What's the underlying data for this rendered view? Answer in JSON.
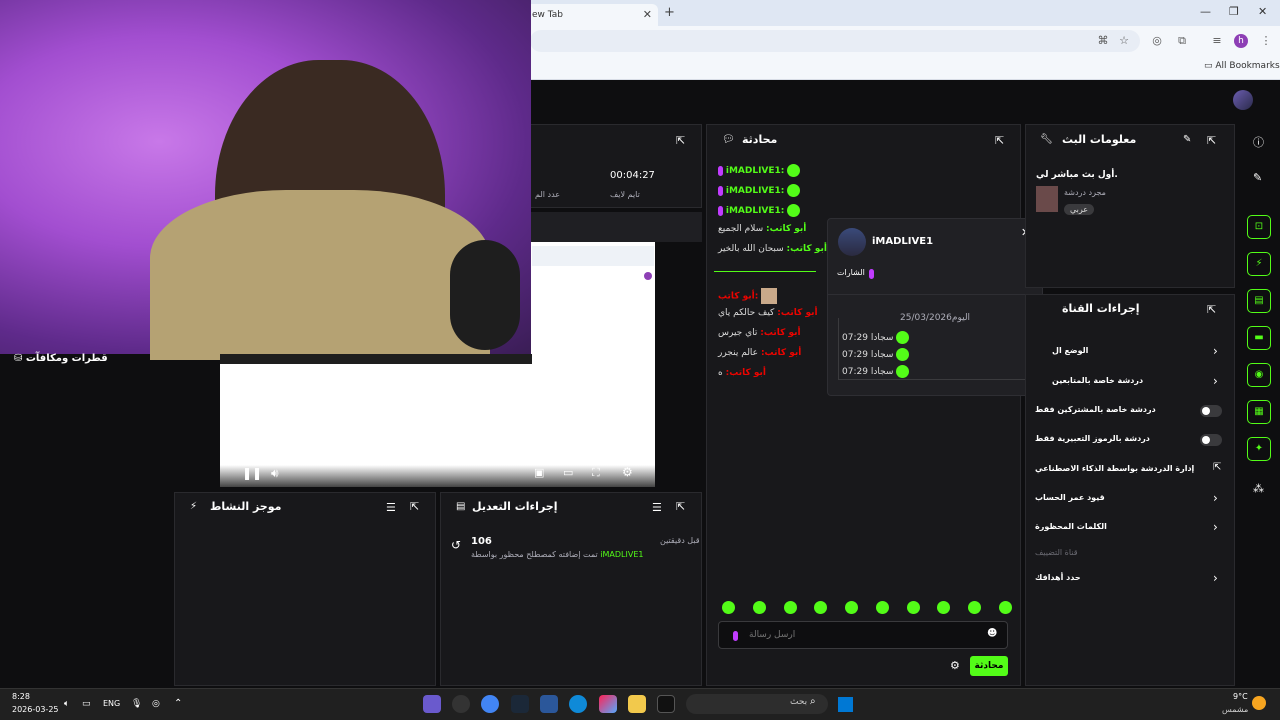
{
  "browser": {
    "tab_title": "ew Tab",
    "bookmarks_label": "All Bookmarks",
    "profile_initial": "h"
  },
  "video": {
    "clip_title": "قطرات ومكافآت"
  },
  "stats": {
    "uptime_value": "00:04:27",
    "uptime_label": "تايم لايف",
    "count_label": "عدد الم"
  },
  "chat": {
    "title": "محادثة",
    "messages": [
      {
        "user": "iMADLIVE1:",
        "text": ""
      },
      {
        "user": "iMADLIVE1:",
        "text": ""
      },
      {
        "user": "iMADLIVE1:",
        "text": ""
      },
      {
        "user": "أبو كاتب:",
        "text": "سلام الجميع"
      },
      {
        "user": "أبو كاتب:",
        "text": "سبحان الله بالخير"
      }
    ],
    "messages2": [
      {
        "user": "أبو كاتب:",
        "text": ""
      },
      {
        "user": "أبو كاتب:",
        "text": "كيف حالكم ياي"
      },
      {
        "user": "أبو كاتب:",
        "text": "تاي جيرس"
      },
      {
        "user": "أبو كاتب:",
        "text": "عالم ينجرر"
      },
      {
        "user": "أبو كاتب:",
        "text": "ه"
      }
    ],
    "input_placeholder": "أرسل رسالة",
    "send_label": "محادثة"
  },
  "user_card": {
    "username": "iMADLIVE1",
    "badges_label": "الشارات",
    "date_header": "اليوم25/03/2026",
    "entries": [
      {
        "time": "07:29",
        "text": "سجادا"
      },
      {
        "time": "07:29",
        "text": "سجادا"
      },
      {
        "time": "07:29",
        "text": "سجادا"
      }
    ]
  },
  "stream_info": {
    "title": "معلومات البث",
    "stream_title": "أول بث مباشر لي.",
    "category": "مجرد دردشة",
    "language_tag": "عربي"
  },
  "channel_actions": {
    "title": "إجراءات القناة",
    "items": [
      {
        "label": "الوضع ال",
        "control": "chevron"
      },
      {
        "label": "دردشة خاصة بالمتابعين",
        "control": "chevron"
      },
      {
        "label": "دردشة خاصة بالمشتركين فقط",
        "control": "toggle"
      },
      {
        "label": "دردشة بالرموز التعبيرية فقط",
        "control": "toggle"
      },
      {
        "label": "إدارة الدردشة بواسطة الذكاء الاصطناعي",
        "control": "external"
      },
      {
        "label": "قيود عمر الحساب",
        "control": "chevron"
      },
      {
        "label": "الكلمات المحظورة",
        "control": "chevron"
      },
      {
        "label": "قناة التضييف",
        "control": "none"
      },
      {
        "label": "حدد أهدافك",
        "control": "chevron"
      }
    ]
  },
  "activity": {
    "title": "موجز النشاط"
  },
  "mod_actions": {
    "title": "إجراءات التعديل",
    "time_ago": "قبل دقيقتين",
    "count": "106",
    "description": "تمت إضافته كمصطلح محظور بواسطة",
    "actor": "iMADLIVE1"
  },
  "taskbar": {
    "time": "8:28",
    "date": "2026-03-25",
    "lang": "ENG",
    "search_placeholder": "بحث",
    "temp": "9°C",
    "weather": "مشمس"
  },
  "colors": {
    "accent": "#53fc18",
    "panel": "#18181b",
    "bg": "#0e0e10"
  }
}
